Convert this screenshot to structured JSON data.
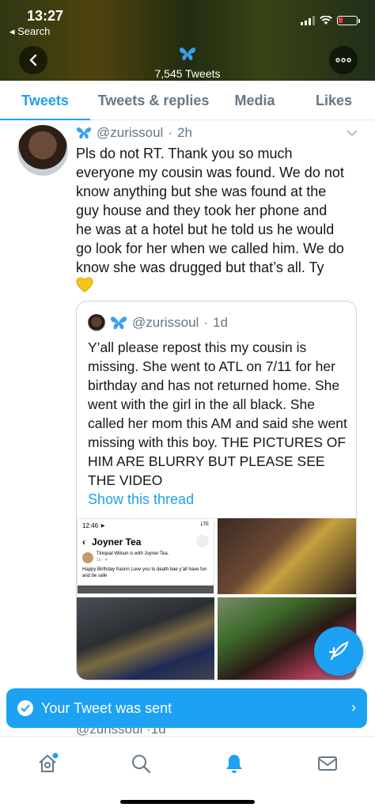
{
  "status_bar": {
    "time": "13:27",
    "back_label": "◂ Search"
  },
  "header": {
    "emoji": "🦋",
    "tweet_count": "7,545 Tweets"
  },
  "tabs": [
    {
      "label": "Tweets",
      "active": true
    },
    {
      "label": "Tweets & replies",
      "active": false
    },
    {
      "label": "Media",
      "active": false
    },
    {
      "label": "Likes",
      "active": false
    }
  ],
  "tweet": {
    "emoji": "🦋",
    "handle": "@zurissoul",
    "dot": "·",
    "time": "2h",
    "text": "Pls do not RT. Thank you so much everyone my cousin was found. We do not know anything but she was found at the guy house and they took her phone and he was at a hotel but he told us he would go look for her when we called him. We do know she was drugged but that’s all. Ty",
    "end_emoji": "💛"
  },
  "quote": {
    "emoji": "🦋",
    "handle": "@zurissoul",
    "dot": "·",
    "time": "1d",
    "text": "Y’all please repost this my cousin is missing. She went to ATL on 7/11 for her birthday and has not returned home. She went with the girl in the all black. She called her mom this AM and said she went missing with this boy. THE PICTURES OF HIM ARE BLURRY BUT PLEASE SEE THE VIDEO",
    "link": "Show this thread",
    "screenshot": {
      "time": "12:46 ➤",
      "network": "LTE",
      "title": "Joyner Tea",
      "back": "‹",
      "poster": "Tiniqual Wilson is with Joyner Tea.",
      "date": "1d · ☀",
      "body": "Happy Birthday frannn Love you to death bae y’all have fun and be safe"
    }
  },
  "peek": {
    "handle": "@zurissoul",
    "dot": "·",
    "time": "1d"
  },
  "toast": {
    "message": "Your Tweet was sent",
    "chevron": "›"
  },
  "colors": {
    "accent": "#1da1f2",
    "text": "#14171a",
    "muted": "#657786"
  },
  "bottom_nav": [
    "home-icon",
    "search-icon",
    "notifications-icon",
    "messages-icon"
  ]
}
